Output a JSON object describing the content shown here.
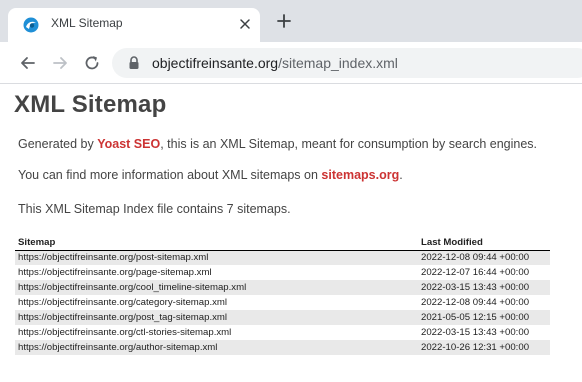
{
  "browser": {
    "tab_title": "XML Sitemap",
    "url_host": "objectifreinsante.org",
    "url_path": "/sitemap_index.xml"
  },
  "page": {
    "heading": "XML Sitemap",
    "line1": {
      "prefix": "Generated by ",
      "link": "Yoast SEO",
      "suffix": ", this is an XML Sitemap, meant for consumption by search engines."
    },
    "line2": {
      "prefix": "You can find more information about XML sitemaps on ",
      "link": "sitemaps.org",
      "suffix": "."
    },
    "line3": "This XML Sitemap Index file contains 7 sitemaps.",
    "table": {
      "headers": [
        "Sitemap",
        "Last Modified"
      ],
      "rows": [
        [
          "https://objectifreinsante.org/post-sitemap.xml",
          "2022-12-08 09:44 +00:00"
        ],
        [
          "https://objectifreinsante.org/page-sitemap.xml",
          "2022-12-07 16:44 +00:00"
        ],
        [
          "https://objectifreinsante.org/cool_timeline-sitemap.xml",
          "2022-03-15 13:43 +00:00"
        ],
        [
          "https://objectifreinsante.org/category-sitemap.xml",
          "2022-12-08 09:44 +00:00"
        ],
        [
          "https://objectifreinsante.org/post_tag-sitemap.xml",
          "2021-05-05 12:15 +00:00"
        ],
        [
          "https://objectifreinsante.org/ctl-stories-sitemap.xml",
          "2022-03-15 13:43 +00:00"
        ],
        [
          "https://objectifreinsante.org/author-sitemap.xml",
          "2022-10-26 12:31 +00:00"
        ]
      ]
    }
  },
  "colors": {
    "link": "#cc3333",
    "row_stripe": "#e9e9e9",
    "tabstrip": "#dee1e6",
    "omnibox": "#f1f3f4"
  },
  "icons": {
    "favicon": "sitemap-favicon-icon",
    "tab_close": "close-icon",
    "new_tab": "plus-icon",
    "back": "back-arrow-icon",
    "forward": "forward-arrow-icon",
    "reload": "reload-icon",
    "secure": "lock-icon"
  }
}
